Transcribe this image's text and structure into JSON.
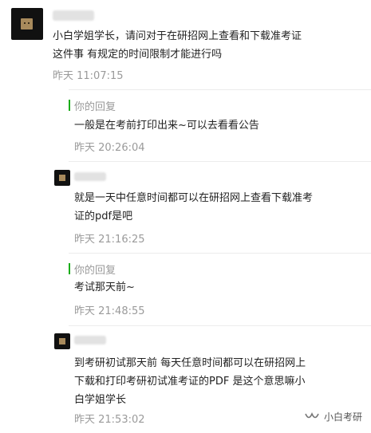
{
  "original": {
    "message": "小白学姐学长，请问对于在研招网上查看和下载准考证\n这件事 有规定的时间限制才能进行吗",
    "time": "昨天 11:07:15"
  },
  "replies": [
    {
      "type": "mine",
      "label": "你的回复",
      "message": "一般是在考前打印出来~可以去看看公告",
      "time": "昨天 20:26:04"
    },
    {
      "type": "user",
      "message": "就是一天中任意时间都可以在研招网上查看下载准考\n证的pdf是吧",
      "time": "昨天 21:16:25"
    },
    {
      "type": "mine",
      "label": "你的回复",
      "message": "考试那天前~",
      "time": "昨天 21:48:55"
    },
    {
      "type": "user",
      "message": "到考研初试那天前 每天任意时间都可以在研招网上\n下载和打印考研初试准考证的PDF  是这个意思嘛小\n白学姐学长",
      "time": "昨天 21:53:02"
    }
  ],
  "watermark": {
    "text": "小白考研",
    "icon": "wechat-channel-icon"
  },
  "colors": {
    "accent": "#1aad19",
    "meta": "#9a9a9a"
  }
}
